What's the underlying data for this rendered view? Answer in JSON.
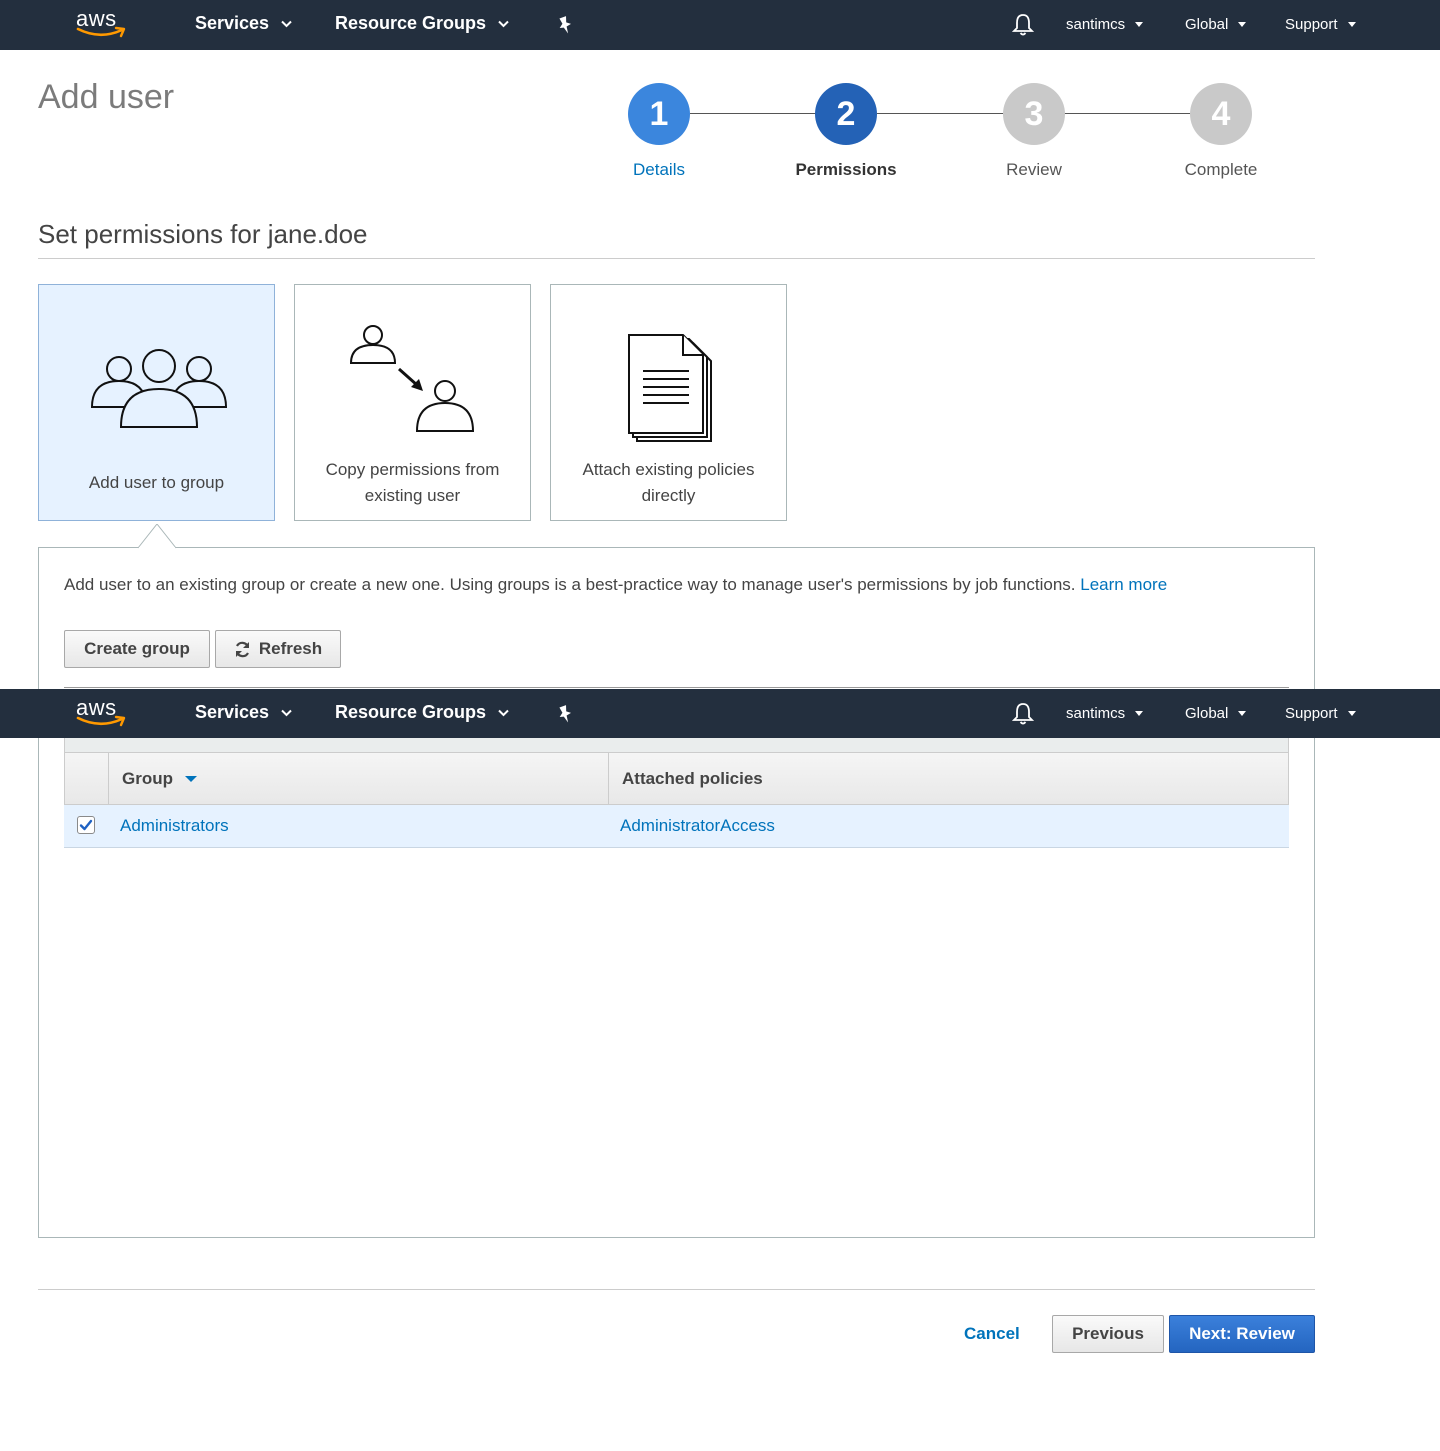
{
  "nav": {
    "logo_text": "aws",
    "services": "Services",
    "resource_groups": "Resource Groups",
    "user": "santimcs",
    "region": "Global",
    "support": "Support"
  },
  "page": {
    "title": "Add user"
  },
  "steps": [
    {
      "number": "1",
      "label": "Details",
      "state": "done"
    },
    {
      "number": "2",
      "label": "Permissions",
      "state": "active"
    },
    {
      "number": "3",
      "label": "Review",
      "state": "pending"
    },
    {
      "number": "4",
      "label": "Complete",
      "state": "pending"
    }
  ],
  "section": {
    "title": "Set permissions for jane.doe"
  },
  "options": [
    {
      "label_line1": "Add user to group",
      "label_line2": "",
      "selected": true
    },
    {
      "label_line1": "Copy permissions from",
      "label_line2": "existing user",
      "selected": false
    },
    {
      "label_line1": "Attach existing policies",
      "label_line2": "directly",
      "selected": false
    }
  ],
  "panel": {
    "description": "Add user to an existing group or create a new one. Using groups is a best-practice way to manage user's permissions by job functions.",
    "learn_more": "Learn more",
    "create_group": "Create group",
    "refresh": "Refresh"
  },
  "table": {
    "columns": [
      "Group",
      "Attached policies"
    ],
    "rows": [
      {
        "checked": true,
        "group": "Administrators",
        "policies": "AdministratorAccess"
      }
    ]
  },
  "footer": {
    "cancel": "Cancel",
    "previous": "Previous",
    "next": "Next: Review"
  },
  "colors": {
    "nav_bg": "#232f3e",
    "step_done": "#3b86dd",
    "step_active": "#2462b6",
    "step_pending": "#c9c9c9",
    "link": "#0073bb",
    "selected_bg": "#e6f2ff",
    "primary": "#2a6cc8"
  }
}
